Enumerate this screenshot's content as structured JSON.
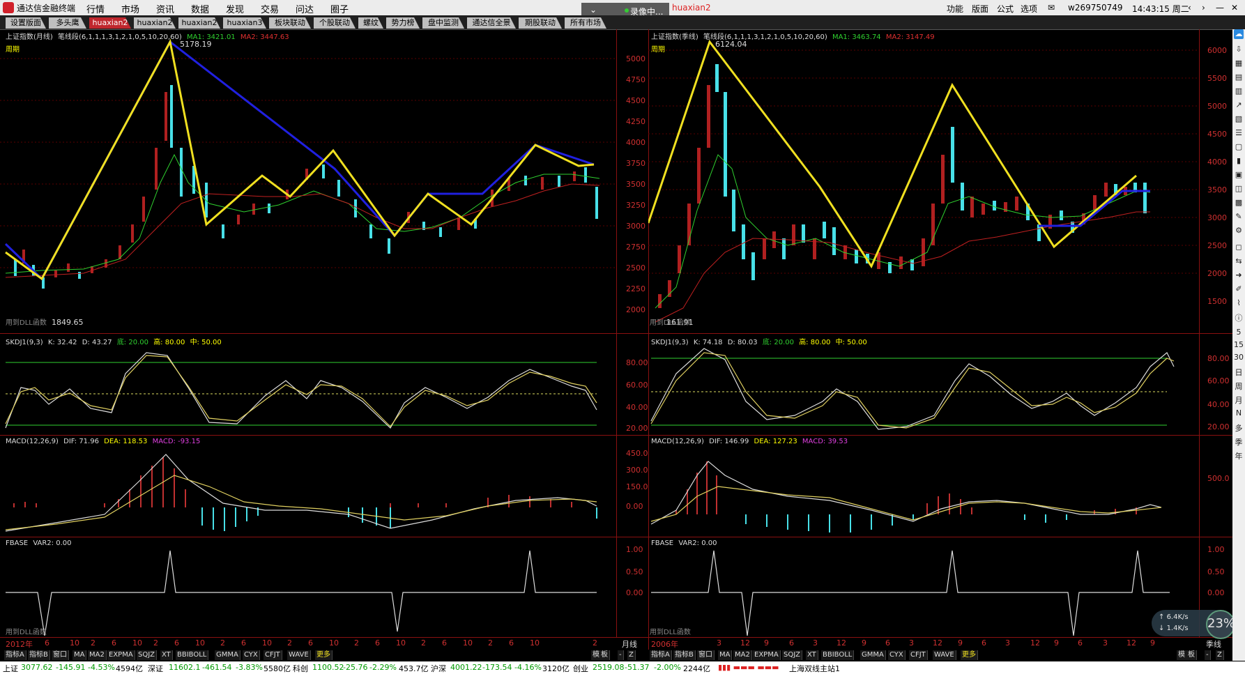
{
  "app": {
    "name": "通达信金融终端",
    "menu": [
      "行情",
      "市场",
      "资讯",
      "数据",
      "发现",
      "交易",
      "问达",
      "圈子"
    ],
    "right_menu": [
      "功能",
      "版面",
      "公式",
      "选项"
    ],
    "user": "w269750749",
    "time": "14:43:15 周二",
    "recording": "录像中...",
    "record_title": "huaxian2"
  },
  "tabs": [
    {
      "label": "设置版面",
      "active": false
    },
    {
      "label": "多头鹰",
      "active": false
    },
    {
      "label": "huaxian2",
      "active": true
    },
    {
      "label": "huaxian2",
      "active": false
    },
    {
      "label": "huaxian2",
      "active": false
    },
    {
      "label": "huaxian3",
      "active": false
    },
    {
      "label": "板块联动",
      "active": false
    },
    {
      "label": "个股联动",
      "active": false
    },
    {
      "label": "螺纹",
      "active": false
    },
    {
      "label": "势力榜",
      "active": false
    },
    {
      "label": "盘中监测",
      "active": false
    },
    {
      "label": "通达信全景",
      "active": false
    },
    {
      "label": "期股联动",
      "active": false
    },
    {
      "label": "所有市场",
      "active": false
    }
  ],
  "left": {
    "main_title": "上证指数(月线)",
    "indicator": "笔线段(6,1,1,1,3,1,2,1,0,5,10,20,60)",
    "ma1": "MA1: 3421.01",
    "ma2": "MA2: 3447.63",
    "period": "周期",
    "high_label": "5178.19",
    "low_label": "1849.65",
    "dll": "用到DLL函数",
    "yticks": [
      "5000",
      "4750",
      "4500",
      "4250",
      "4000",
      "3750",
      "3500",
      "3250",
      "3000",
      "2750",
      "2500",
      "2250",
      "2000"
    ],
    "kdj_title": "SKDJ1(9,3)",
    "kdj_k": "K: 32.42",
    "kdj_d": "D: 43.27",
    "kdj_low": "底: 20.00",
    "kdj_high": "高: 80.00",
    "kdj_mid": "中: 50.00",
    "kdj_ticks": [
      "80.00",
      "60.00",
      "40.00",
      "20.00"
    ],
    "macd_title": "MACD(12,26,9)",
    "macd_dif": "DIF: 71.96",
    "macd_dea": "DEA: 118.53",
    "macd_val": "MACD: -93.15",
    "macd_ticks": [
      "450.0",
      "300.0",
      "150.0",
      "0.00"
    ],
    "fbase_title": "FBASE",
    "fbase_var": "VAR2: 0.00",
    "fbase_ticks": [
      "1.00",
      "0.50",
      "0.00"
    ],
    "x_labels": [
      "2012年",
      "6",
      "10",
      "2",
      "6",
      "10",
      "2",
      "6",
      "10",
      "2",
      "6",
      "10",
      "2",
      "6",
      "10",
      "2",
      "6",
      "10",
      "2",
      "6",
      "10",
      "2",
      "6",
      "10",
      "2"
    ],
    "period_btn": "月线"
  },
  "right": {
    "main_title": "上证指数(季线)",
    "indicator": "笔线段(6,1,1,1,3,1,2,1,0,5,10,20,60)",
    "ma1": "MA1: 3463.74",
    "ma2": "MA2: 3147.49",
    "period": "周期",
    "high_label": "6124.04",
    "low_label": "161.91",
    "dll": "用到DLL函数",
    "yticks": [
      "6000",
      "5500",
      "5000",
      "4500",
      "4000",
      "3500",
      "3000",
      "2500",
      "2000",
      "1500"
    ],
    "kdj_title": "SKDJ1(9,3)",
    "kdj_k": "K: 74.18",
    "kdj_d": "D: 80.03",
    "kdj_low": "底: 20.00",
    "kdj_high": "高: 80.00",
    "kdj_mid": "中: 50.00",
    "kdj_ticks": [
      "80.00",
      "60.00",
      "40.00",
      "20.00"
    ],
    "macd_title": "MACD(12,26,9)",
    "macd_dif": "DIF: 146.99",
    "macd_dea": "DEA: 127.23",
    "macd_val": "MACD: 39.53",
    "macd_ticks": [
      "500.0"
    ],
    "fbase_title": "FBASE",
    "fbase_var": "VAR2: 0.00",
    "fbase_ticks": [
      "1.00",
      "0.50",
      "0.00"
    ],
    "x_labels": [
      "2006年",
      "3",
      "12",
      "9",
      "6",
      "3",
      "12",
      "9",
      "6",
      "3",
      "12",
      "9",
      "6",
      "3",
      "12",
      "9",
      "6",
      "3",
      "12",
      "9"
    ],
    "period_btn": "季线"
  },
  "toolbar_items": [
    "指标A",
    "指标B",
    "窗口",
    "MA",
    "MA2",
    "EXPMA",
    "SQJZ",
    "XT",
    "BBIBOLL",
    "GMMA",
    "CYX",
    "CFJT",
    "WAVE",
    "更多"
  ],
  "toolbar_right": [
    "模",
    "板",
    "-",
    "Z"
  ],
  "status": {
    "sh": "上证",
    "sh_val": "3077.62",
    "sh_chg": "-145.91",
    "sh_pct": "-4.53%",
    "sh_amt": "4594亿",
    "sz": "深证",
    "sz_val": "11602.1",
    "sz_chg": "-461.54",
    "sz_pct": "-3.83%",
    "sz_amt": "5580亿",
    "kc": "科创",
    "kc_val": "1100.52",
    "kc_chg": "-25.76",
    "kc_pct": "-2.29%",
    "kc_amt": "453.7亿",
    "hs": "沪深",
    "hs_val": "4001.22",
    "hs_chg": "-173.54",
    "hs_pct": "-4.16%",
    "hs_amt": "3120亿",
    "cy": "创业",
    "cy_val": "2519.08",
    "cy_chg": "-51.37",
    "cy_pct": "-2.00%",
    "cy_amt": "2244亿",
    "server": "上海双线主站1"
  },
  "speed": {
    "up": "6.4K/s",
    "down": "1.4K/s",
    "pct": "23%"
  },
  "sidebar_items": [
    "5",
    "15",
    "30",
    "日",
    "周",
    "月",
    "N",
    "多",
    "季",
    "年"
  ]
}
